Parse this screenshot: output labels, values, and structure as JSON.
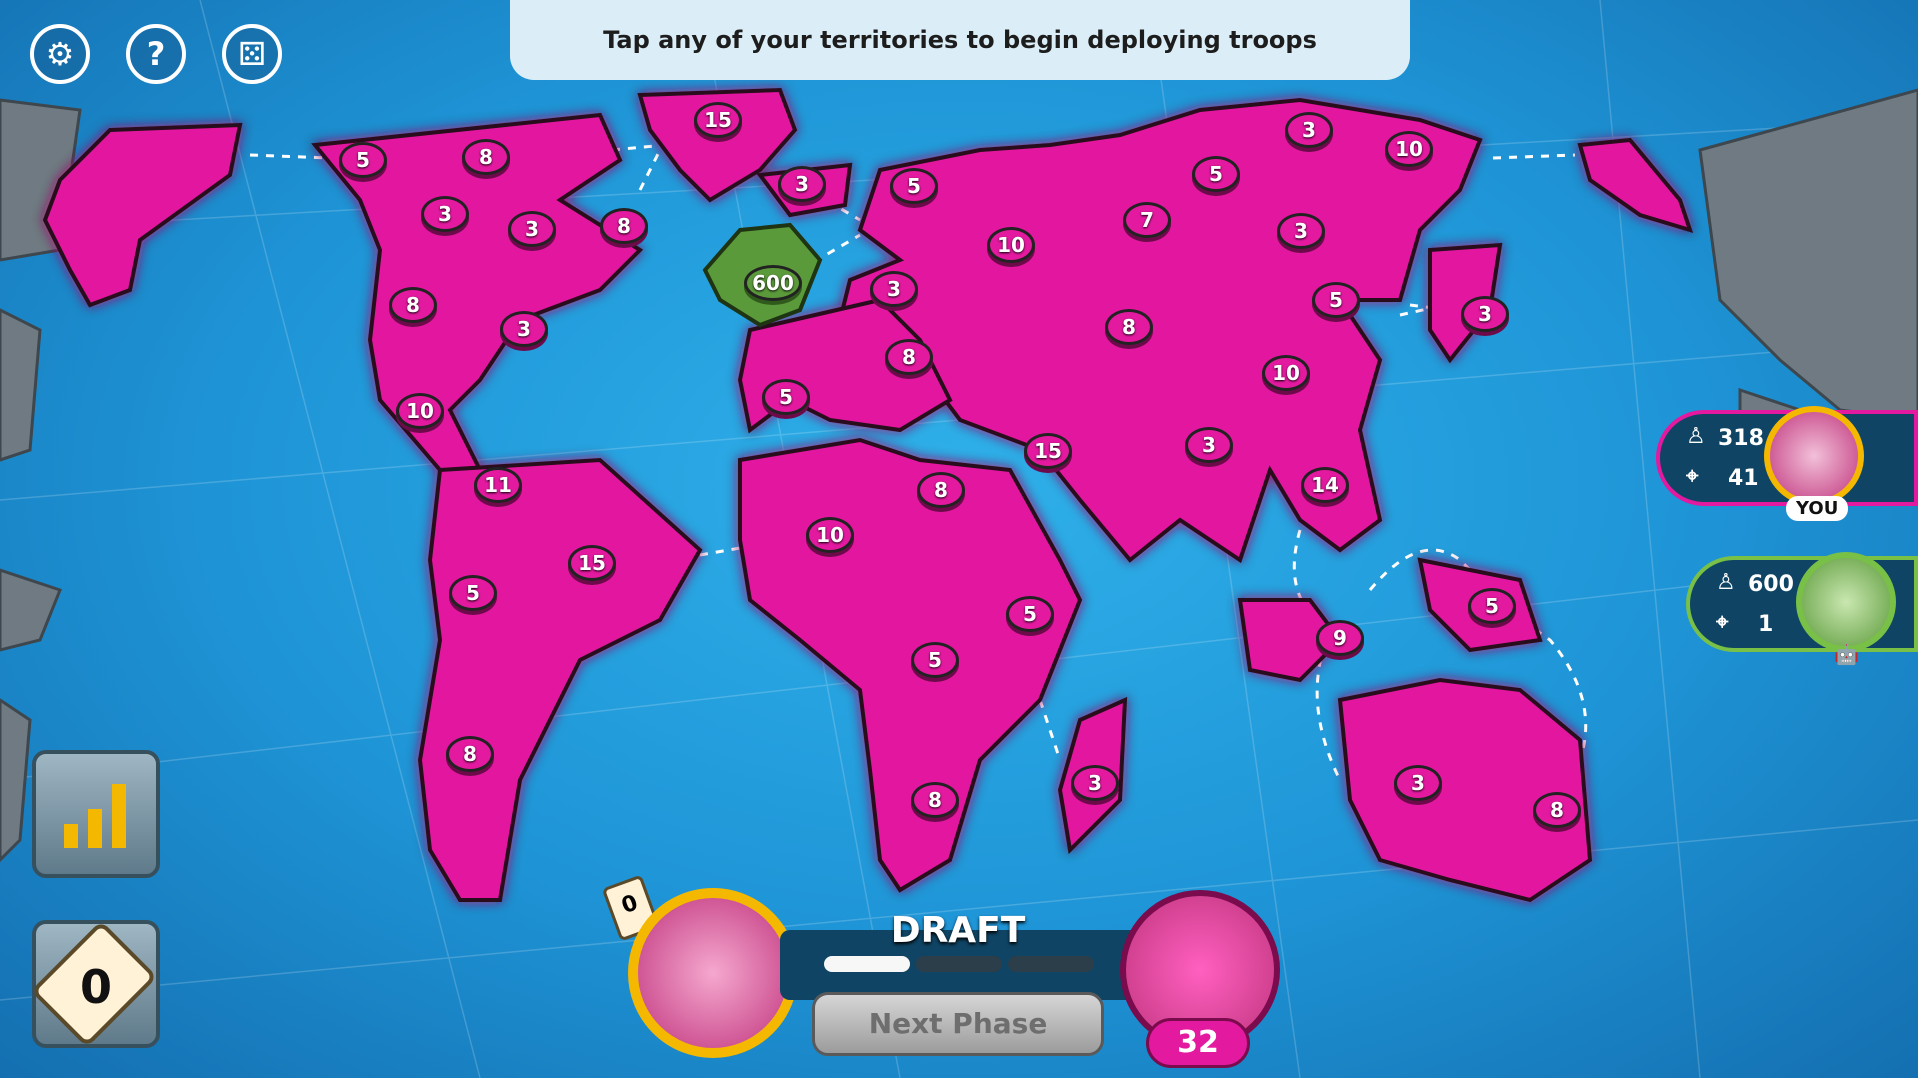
{
  "banner": {
    "instruction": "Tap any of your territories to begin deploying troops"
  },
  "top_icons": [
    {
      "name": "settings",
      "icon": "gear-icon",
      "glyph": "⚙"
    },
    {
      "name": "help",
      "icon": "question-icon",
      "glyph": "?"
    },
    {
      "name": "dice",
      "icon": "dice-icon",
      "glyph": "⚄"
    }
  ],
  "colors": {
    "player": "#e3199f",
    "opponent": "#5b9a3a",
    "ocean": "#1e94d6",
    "land_neutral": "#6f7a82"
  },
  "territories": [
    {
      "id": "kamchatka-left",
      "troops": null
    },
    {
      "id": "alaska",
      "troops": "5"
    },
    {
      "id": "northwest-territory",
      "troops": "8"
    },
    {
      "id": "greenland",
      "troops": "15"
    },
    {
      "id": "alberta",
      "troops": "3"
    },
    {
      "id": "ontario",
      "troops": "3"
    },
    {
      "id": "quebec",
      "troops": "8"
    },
    {
      "id": "western-us",
      "troops": "8"
    },
    {
      "id": "eastern-us",
      "troops": "3"
    },
    {
      "id": "central-america",
      "troops": "10"
    },
    {
      "id": "iceland",
      "troops": "3"
    },
    {
      "id": "great-britain",
      "troops": "600",
      "owner": "opponent"
    },
    {
      "id": "scandinavia",
      "troops": "5"
    },
    {
      "id": "northern-europe",
      "troops": "3"
    },
    {
      "id": "western-europe",
      "troops": "5"
    },
    {
      "id": "southern-europe",
      "troops": "8"
    },
    {
      "id": "ukraine",
      "troops": "10"
    },
    {
      "id": "ural",
      "troops": "7"
    },
    {
      "id": "siberia",
      "troops": "5"
    },
    {
      "id": "yakutsk",
      "troops": "3"
    },
    {
      "id": "kamchatka",
      "troops": "10"
    },
    {
      "id": "irkutsk",
      "troops": "3"
    },
    {
      "id": "afghanistan",
      "troops": "8"
    },
    {
      "id": "mongolia",
      "troops": "5"
    },
    {
      "id": "japan",
      "troops": "3"
    },
    {
      "id": "china",
      "troops": "10"
    },
    {
      "id": "middle-east",
      "troops": "15"
    },
    {
      "id": "india",
      "troops": "3"
    },
    {
      "id": "siam",
      "troops": "14"
    },
    {
      "id": "venezuela",
      "troops": "11"
    },
    {
      "id": "brazil",
      "troops": "15"
    },
    {
      "id": "peru",
      "troops": "5"
    },
    {
      "id": "argentina",
      "troops": "8"
    },
    {
      "id": "north-africa",
      "troops": "10"
    },
    {
      "id": "egypt",
      "troops": "8"
    },
    {
      "id": "east-africa",
      "troops": "5"
    },
    {
      "id": "congo",
      "troops": "5"
    },
    {
      "id": "south-africa",
      "troops": "8"
    },
    {
      "id": "madagascar",
      "troops": "3"
    },
    {
      "id": "indonesia",
      "troops": "9"
    },
    {
      "id": "new-guinea",
      "troops": "5"
    },
    {
      "id": "western-australia",
      "troops": "3"
    },
    {
      "id": "eastern-australia",
      "troops": "8"
    },
    {
      "id": "alaska-right",
      "troops": null
    }
  ],
  "players": [
    {
      "name": "you",
      "troops": "318",
      "territories": "41",
      "tag": "YOU"
    },
    {
      "name": "ai",
      "troops": "600",
      "territories": "1",
      "tag": "bot-icon"
    }
  ],
  "left_panel": {
    "stats_icon": "bar-chart-icon",
    "card_count": "0"
  },
  "bottom": {
    "card_badge": "0",
    "phase": "DRAFT",
    "next_phase_label": "Next Phase",
    "reinforcements": "32",
    "progress_segments": 3,
    "progress_active": 1
  }
}
